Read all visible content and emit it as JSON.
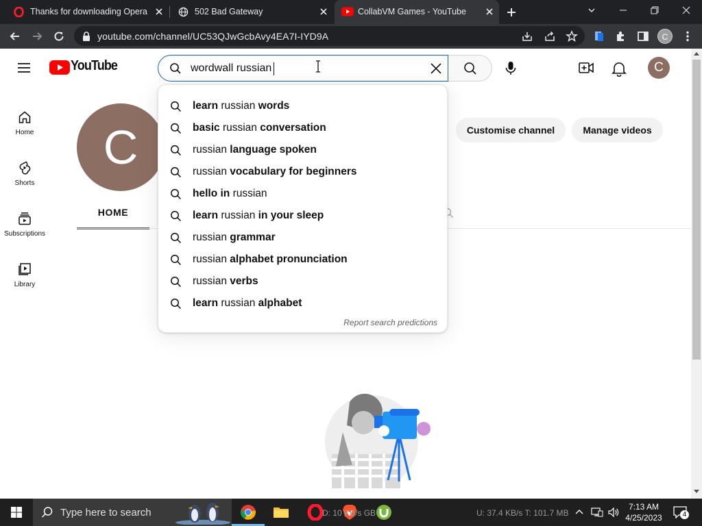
{
  "browser": {
    "tabs": [
      {
        "title": "Thanks for downloading Opera",
        "icon": "opera-icon"
      },
      {
        "title": "502 Bad Gateway",
        "icon": "globe-icon"
      },
      {
        "title": "CollabVM Games - YouTube",
        "icon": "youtube-icon"
      }
    ],
    "active_tab": 2,
    "url": "youtube.com/channel/UC53QJwGcbAvy4EA7I-IYD9A",
    "profile_initial": "C"
  },
  "youtube": {
    "logo_text": "YouTube",
    "search_value": "wordwall russian",
    "avatar_initial": "C",
    "guide": [
      {
        "label": "Home",
        "icon": "home-icon"
      },
      {
        "label": "Shorts",
        "icon": "shorts-icon"
      },
      {
        "label": "Subscriptions",
        "icon": "subscriptions-icon"
      },
      {
        "label": "Library",
        "icon": "library-icon"
      }
    ],
    "suggestions": [
      {
        "pre": "learn ",
        "plain": "russian",
        "post": " words"
      },
      {
        "pre": "basic ",
        "plain": "russian",
        "post": " conversation"
      },
      {
        "pre": "",
        "plain": "russian",
        "post": " language spoken"
      },
      {
        "pre": "",
        "plain": "russian",
        "post": " vocabulary for beginners"
      },
      {
        "pre": "hello in ",
        "plain": "russian",
        "post": ""
      },
      {
        "pre": "learn ",
        "plain": "russian",
        "post": " in your sleep"
      },
      {
        "pre": "",
        "plain": "russian",
        "post": " grammar"
      },
      {
        "pre": "",
        "plain": "russian",
        "post": " alphabet pronunciation"
      },
      {
        "pre": "",
        "plain": "russian",
        "post": " verbs"
      },
      {
        "pre": "learn ",
        "plain": "russian",
        "post": " alphabet"
      }
    ],
    "report_label": "Report search predictions",
    "channel_initial": "C",
    "customise_label": "Customise channel",
    "manage_label": "Manage videos",
    "home_tab_label": "HOME"
  },
  "taskbar": {
    "search_placeholder": "Type here to search",
    "net_left": "D: 10 KB/s   GB",
    "net_right": "U: 37.4 KB/s T: 101.7 MB",
    "time": "7:13 AM",
    "date": "4/25/2023",
    "notification_count": "4"
  },
  "colors": {
    "youtube_red": "#ff0000",
    "avatar_brown": "#8d6e63",
    "search_focus_blue": "#1c62b9",
    "browser_dark": "#202124"
  }
}
